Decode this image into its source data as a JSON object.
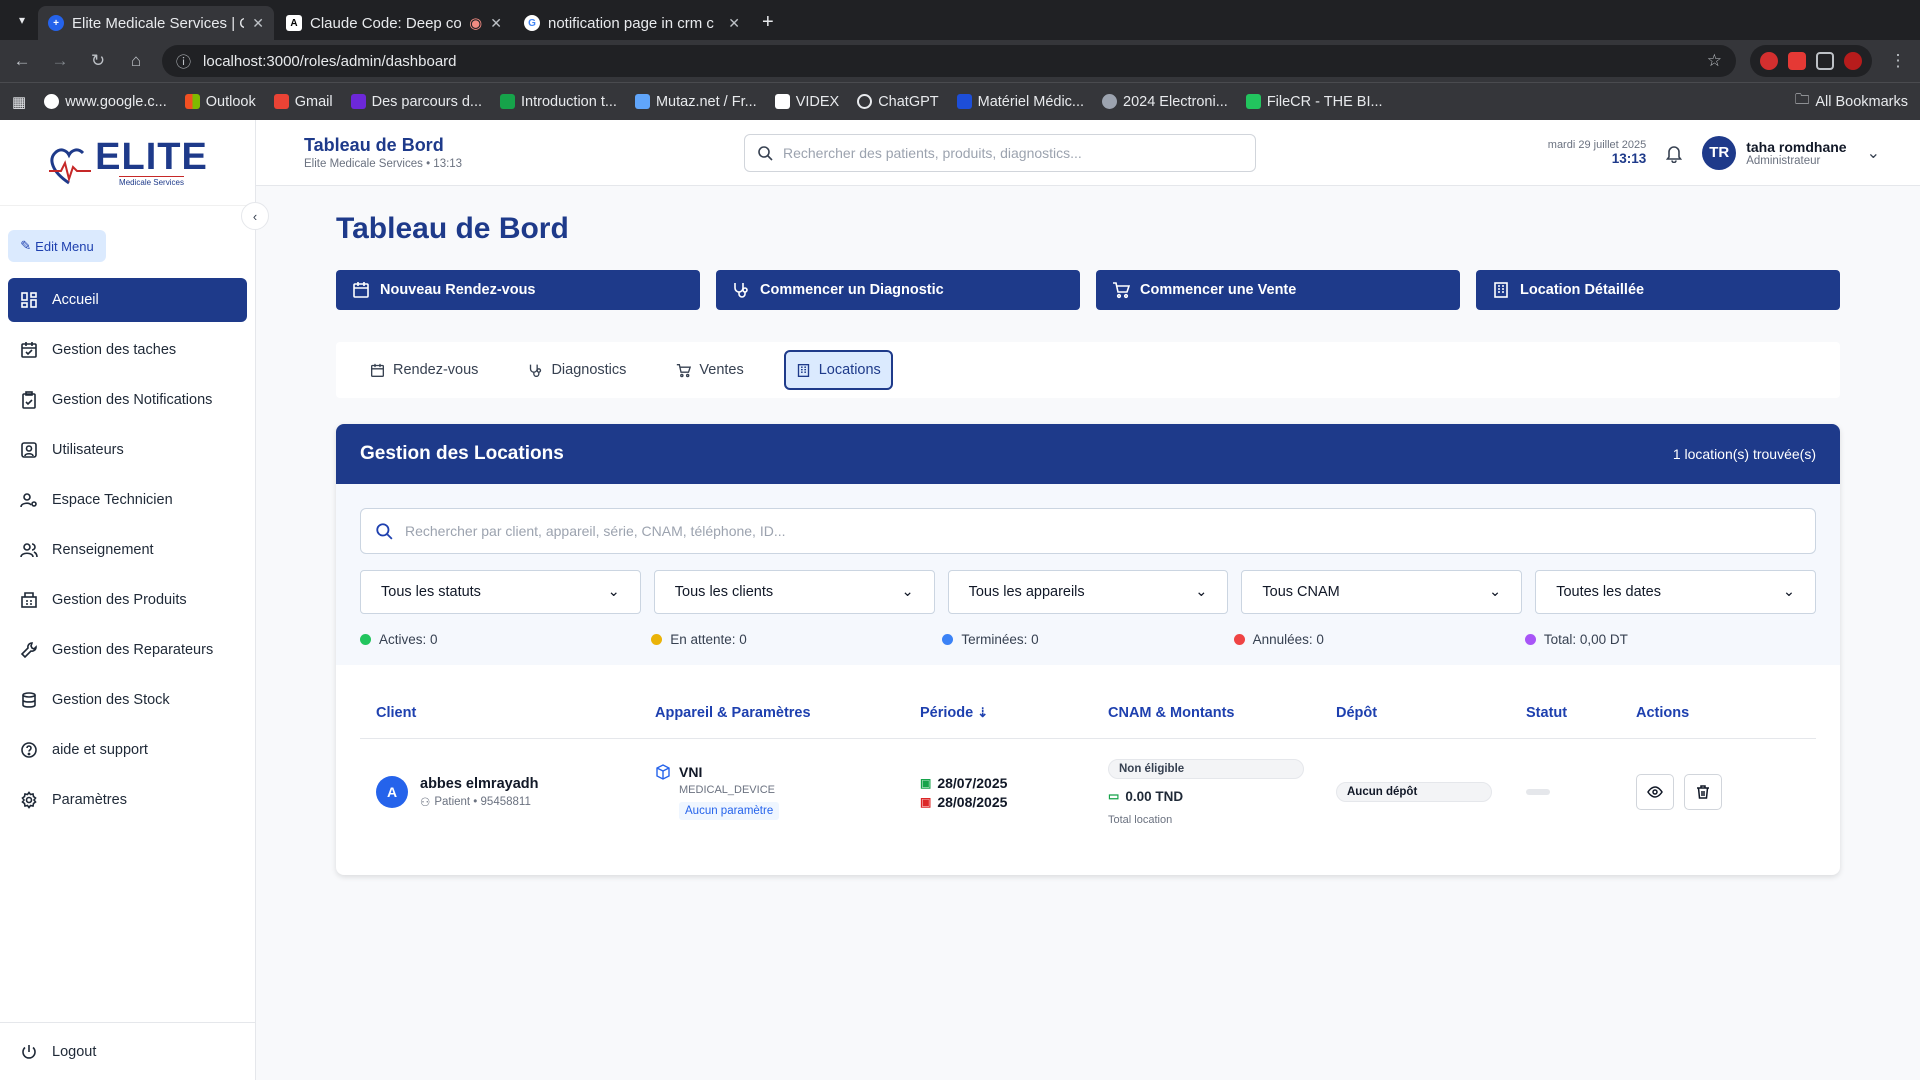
{
  "browser": {
    "tabs": [
      {
        "title": "Elite Medicale Services | C",
        "active": true
      },
      {
        "title": "Claude Code: Deep co",
        "active": false
      },
      {
        "title": "notification page in crm c",
        "active": false
      }
    ],
    "url": "localhost:3000/roles/admin/dashboard",
    "bookmarks": [
      "www.google.c...",
      "Outlook",
      "Gmail",
      "Des parcours d...",
      "Introduction t...",
      "Mutaz.net / Fr...",
      "VIDEX",
      "ChatGPT",
      "Matériel Médic...",
      "2024 Electroni...",
      "FileCR - THE BI..."
    ],
    "all_bookmarks": "All Bookmarks"
  },
  "sidebar": {
    "logo_big": "ELITE",
    "logo_small": "Medicale Services",
    "edit_menu": "Edit Menu",
    "items": [
      {
        "label": "Accueil",
        "icon": "dashboard-icon",
        "active": true
      },
      {
        "label": "Gestion des taches",
        "icon": "calendar-check-icon"
      },
      {
        "label": "Gestion des Notifications",
        "icon": "clipboard-check-icon"
      },
      {
        "label": "Utilisateurs",
        "icon": "users-square-icon"
      },
      {
        "label": "Espace Technicien",
        "icon": "user-cog-icon"
      },
      {
        "label": "Renseignement",
        "icon": "users-icon"
      },
      {
        "label": "Gestion des Produits",
        "icon": "building-icon"
      },
      {
        "label": "Gestion des Reparateurs",
        "icon": "wrench-icon"
      },
      {
        "label": "Gestion des Stock",
        "icon": "database-icon"
      },
      {
        "label": "aide et support",
        "icon": "help-icon"
      },
      {
        "label": "Paramètres",
        "icon": "settings-icon"
      }
    ],
    "logout": "Logout"
  },
  "topbar": {
    "title": "Tableau de Bord",
    "subtitle": "Elite Medicale Services • 13:13",
    "search_placeholder": "Rechercher des patients, produits, diagnostics...",
    "date": "mardi 29 juillet 2025",
    "time": "13:13",
    "avatar": "TR",
    "user_name": "taha romdhane",
    "user_role": "Administrateur"
  },
  "page": {
    "title": "Tableau de Bord",
    "actions": [
      "Nouveau Rendez-vous",
      "Commencer un Diagnostic",
      "Commencer une Vente",
      "Location Détaillée"
    ],
    "tabs": [
      {
        "label": "Rendez-vous",
        "active": false
      },
      {
        "label": "Diagnostics",
        "active": false
      },
      {
        "label": "Ventes",
        "active": false
      },
      {
        "label": "Locations",
        "active": true
      }
    ]
  },
  "locations": {
    "title": "Gestion des Locations",
    "count": "1 location(s) trouvée(s)",
    "search_placeholder": "Rechercher par client, appareil, série, CNAM, téléphone, ID...",
    "filters": [
      "Tous les statuts",
      "Tous les clients",
      "Tous les appareils",
      "Tous CNAM",
      "Toutes les dates"
    ],
    "stats": [
      {
        "label": "Actives: 0",
        "color": "#22c55e"
      },
      {
        "label": "En attente: 0",
        "color": "#eab308"
      },
      {
        "label": "Terminées: 0",
        "color": "#3b82f6"
      },
      {
        "label": "Annulées: 0",
        "color": "#ef4444"
      },
      {
        "label": "Total: 0,00 DT",
        "color": "#a855f7"
      }
    ],
    "columns": [
      "Client",
      "Appareil & Paramètres",
      "Période",
      "CNAM & Montants",
      "Dépôt",
      "Statut",
      "Actions"
    ],
    "rows": [
      {
        "avatar": "A",
        "client": "abbes elmrayadh",
        "client_sub": "Patient • 95458811",
        "device": "VNI",
        "device_type": "MEDICAL_DEVICE",
        "params": "Aucun paramètre",
        "start": "28/07/2025",
        "end": "28/08/2025",
        "cnam": "Non éligible",
        "amount": "0.00 TND",
        "amount_label": "Total location",
        "deposit": "Aucun dépôt"
      }
    ]
  },
  "colors": {
    "primary": "#1e3a8a",
    "accent": "#2563eb"
  }
}
